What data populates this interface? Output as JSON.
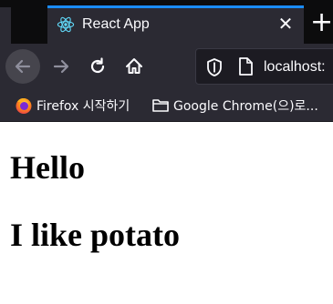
{
  "browser": {
    "tab": {
      "title": "React App",
      "icon": "react-icon",
      "close_label": "✕"
    },
    "new_tab_label": "+",
    "url": "localhost:",
    "accent_color": "#1a8cff"
  },
  "bookmarks": [
    {
      "label": "Firefox 시작하기",
      "icon": "firefox-icon"
    },
    {
      "label": "Google Chrome(으)로...",
      "icon": "folder-icon"
    }
  ],
  "page": {
    "headings": [
      "Hello",
      "I like potato"
    ]
  }
}
